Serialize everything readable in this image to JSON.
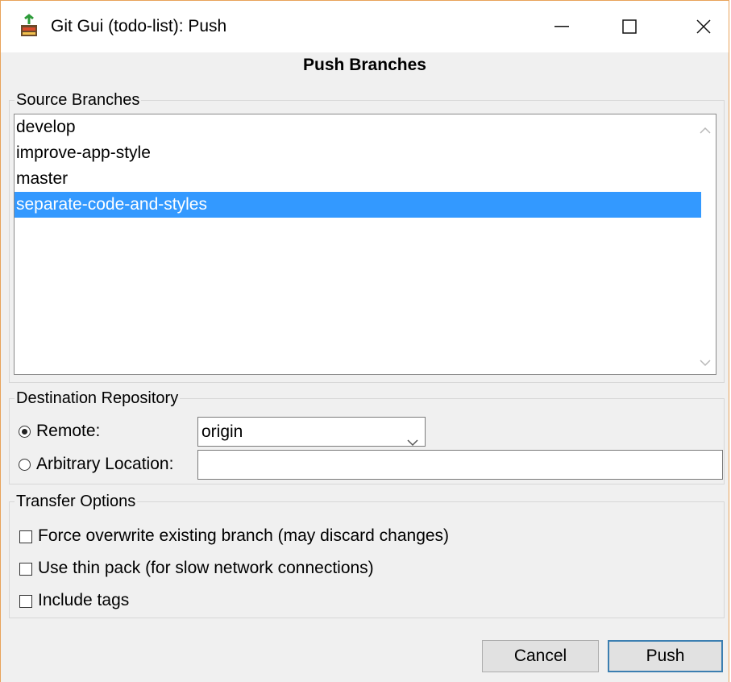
{
  "window": {
    "title": "Git Gui (todo-list): Push",
    "controls": {
      "minimize": "—",
      "maximize": "□",
      "close": "✕"
    }
  },
  "heading": "Push Branches",
  "source_branches": {
    "legend": "Source Branches",
    "items": [
      {
        "label": "develop",
        "selected": false
      },
      {
        "label": "improve-app-style",
        "selected": false
      },
      {
        "label": "master",
        "selected": false
      },
      {
        "label": "separate-code-and-styles",
        "selected": true
      }
    ]
  },
  "destination": {
    "legend": "Destination Repository",
    "remote_label": "Remote:",
    "remote_value": "origin",
    "arbitrary_label": "Arbitrary Location:",
    "arbitrary_value": ""
  },
  "transfer": {
    "legend": "Transfer Options",
    "options": [
      {
        "label": "Force overwrite existing branch (may discard changes)",
        "checked": false
      },
      {
        "label": "Use thin pack (for slow network connections)",
        "checked": false
      },
      {
        "label": "Include tags",
        "checked": false
      }
    ]
  },
  "buttons": {
    "cancel": "Cancel",
    "push": "Push"
  },
  "colors": {
    "selection": "#3399ff",
    "window_border": "#e8a35a",
    "default_button_border": "#3c7fb1"
  }
}
